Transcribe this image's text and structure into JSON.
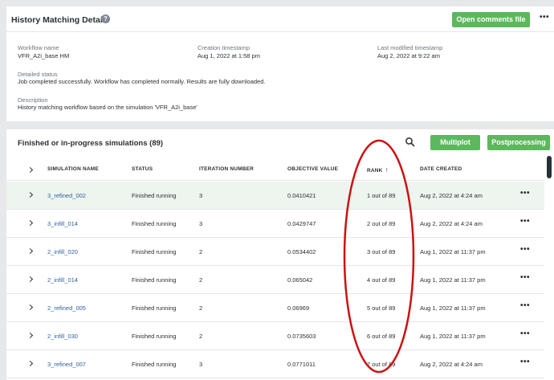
{
  "details": {
    "title": "History Matching Details",
    "help_icon": "?",
    "open_comments_label": "Open comments file",
    "more_icon": "•••",
    "workflow_name_label": "Workflow name",
    "workflow_name": "VFR_A2i_base HM",
    "creation_label": "Creation timestamp",
    "creation_value": "Aug 1, 2022 at 1:58 pm",
    "modified_label": "Last modified timestamp",
    "modified_value": "Aug 2, 2022 at 9:22 am",
    "status_label": "Detailed status",
    "status_value": "Job completed successfully. Workflow has completed normally. Results are fully downloaded.",
    "description_label": "Description",
    "description_value": "History matching workflow based on the simulation 'VFR_A2i_base'"
  },
  "simulations": {
    "title": "Finished or in-progress simulations (89)",
    "multiplot_label": "Multiplot",
    "postprocessing_label": "Postprocessing",
    "columns": {
      "name": "SIMULATION NAME",
      "status": "STATUS",
      "iteration": "ITERATION NUMBER",
      "objective": "OBJECTIVE VALUE",
      "rank": "RANK",
      "date": "DATE CREATED"
    },
    "rank_sort_icon": "↑",
    "more_icon": "•••",
    "rows": [
      {
        "name": "3_refined_002",
        "status": "Finished running",
        "iteration": "3",
        "objective": "0.0410421",
        "rank": "1 out of 89",
        "date": "Aug 2, 2022 at 4:24 am"
      },
      {
        "name": "3_infill_014",
        "status": "Finished running",
        "iteration": "3",
        "objective": "0.0429747",
        "rank": "2 out of 89",
        "date": "Aug 2, 2022 at 4:24 am"
      },
      {
        "name": "2_infill_020",
        "status": "Finished running",
        "iteration": "2",
        "objective": "0.0534402",
        "rank": "3 out of 89",
        "date": "Aug 1, 2022 at 11:37 pm"
      },
      {
        "name": "2_infill_014",
        "status": "Finished running",
        "iteration": "2",
        "objective": "0.065042",
        "rank": "4 out of 89",
        "date": "Aug 1, 2022 at 11:37 pm"
      },
      {
        "name": "2_refined_005",
        "status": "Finished running",
        "iteration": "2",
        "objective": "0.06969",
        "rank": "5 out of 89",
        "date": "Aug 1, 2022 at 11:37 pm"
      },
      {
        "name": "2_infill_030",
        "status": "Finished running",
        "iteration": "2",
        "objective": "0.0735603",
        "rank": "6 out of 89",
        "date": "Aug 1, 2022 at 11:37 pm"
      },
      {
        "name": "3_refined_007",
        "status": "Finished running",
        "iteration": "3",
        "objective": "0.0771011",
        "rank": "7 out of 89",
        "date": "Aug 2, 2022 at 4:24 am"
      }
    ]
  },
  "colors": {
    "accent_green": "#5cb85c",
    "selected_row": "#edf5ee",
    "link_blue": "#2e5f9e",
    "annotation_red": "#cc1111"
  }
}
